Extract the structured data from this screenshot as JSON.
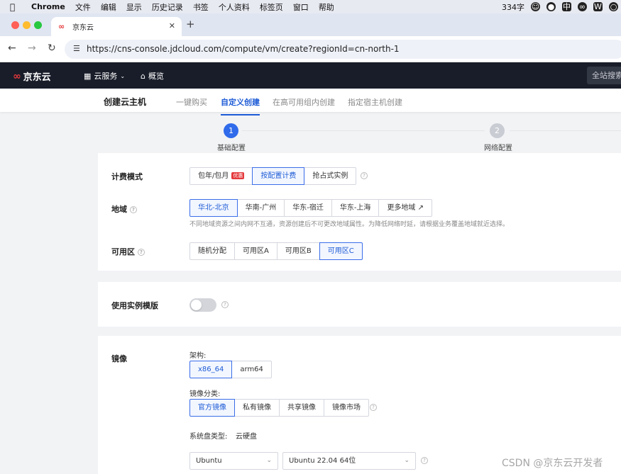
{
  "menubar": {
    "app": "Chrome",
    "items": [
      "文件",
      "编辑",
      "显示",
      "历史记录",
      "书签",
      "个人资料",
      "标签页",
      "窗口",
      "帮助"
    ],
    "word_count": "334字"
  },
  "browser": {
    "tab_title": "京东云",
    "url": "https://cns-console.jdcloud.com/compute/vm/create?regionId=cn-north-1"
  },
  "topnav": {
    "logo_text": "京东云",
    "services": "云服务",
    "overview": "概览",
    "search": "全站搜索"
  },
  "subhead": {
    "title": "创建云主机",
    "tabs": [
      "一键购买",
      "自定义创建",
      "在高可用组内创建",
      "指定宿主机创建"
    ],
    "active_tab": "自定义创建"
  },
  "steps": [
    {
      "num": "1",
      "label": "基础配置",
      "active": true
    },
    {
      "num": "2",
      "label": "网络配置",
      "active": false
    }
  ],
  "billing": {
    "label": "计费模式",
    "options": [
      "包年/包月",
      "按配置计费",
      "抢占式实例"
    ],
    "promo_tag": "优惠",
    "selected": "按配置计费"
  },
  "region": {
    "label": "地域",
    "options": [
      "华北-北京",
      "华南-广州",
      "华东-宿迁",
      "华东-上海",
      "更多地域"
    ],
    "selected": "华北-北京",
    "hint": "不同地域资源之间内网不互通，资源创建后不可更改地域属性。为降低网络时延，请根据业务覆盖地域就近选择。"
  },
  "zone": {
    "label": "可用区",
    "options": [
      "随机分配",
      "可用区A",
      "可用区B",
      "可用区C"
    ],
    "selected": "可用区C"
  },
  "template": {
    "label": "使用实例模版",
    "enabled": false
  },
  "image": {
    "label": "镜像",
    "arch_label": "架构:",
    "arch_options": [
      "x86_64",
      "arm64"
    ],
    "arch_selected": "x86_64",
    "category_label": "镜像分类:",
    "category_options": [
      "官方镜像",
      "私有镜像",
      "共享镜像",
      "镜像市场"
    ],
    "category_selected": "官方镜像",
    "disk_type_label": "系统盘类型:",
    "disk_type_value": "云硬盘",
    "os_value": "Ubuntu",
    "version_value": "Ubuntu 22.04 64位"
  },
  "watermark": "CSDN @京东云开发者",
  "colors": {
    "accent": "#1d5bd6",
    "nav_bg": "#191d29",
    "brand_red": "#e4393c"
  }
}
